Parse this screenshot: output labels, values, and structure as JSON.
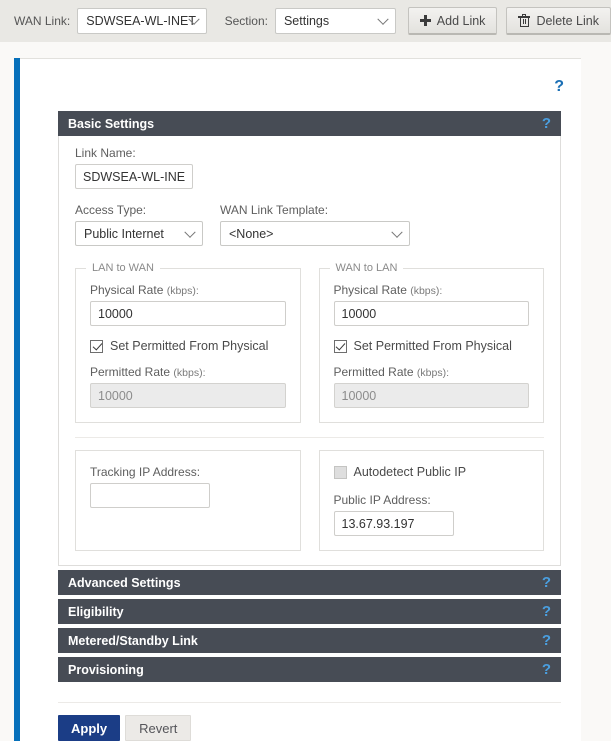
{
  "toolbar": {
    "wan_link_label": "WAN Link:",
    "wan_link_value": "SDWSEA-WL-INET",
    "section_label": "Section:",
    "section_value": "Settings",
    "add_link_label": "Add Link",
    "delete_link_label": "Delete Link"
  },
  "card": {
    "help_glyph": "?"
  },
  "basic_settings": {
    "title": "Basic Settings",
    "help_glyph": "?",
    "link_name_label": "Link Name:",
    "link_name_value": "SDWSEA-WL-INET",
    "access_type_label": "Access Type:",
    "access_type_value": "Public Internet",
    "wan_link_template_label": "WAN Link Template:",
    "wan_link_template_value": "<None>",
    "lan_to_wan": {
      "legend": "LAN to WAN",
      "physical_rate_label": "Physical Rate",
      "physical_rate_unit": "(kbps):",
      "physical_rate_value": "10000",
      "set_permitted_label": "Set Permitted From Physical",
      "set_permitted_checked": true,
      "permitted_rate_label": "Permitted Rate",
      "permitted_rate_unit": "(kbps):",
      "permitted_rate_value": "10000"
    },
    "wan_to_lan": {
      "legend": "WAN to LAN",
      "physical_rate_label": "Physical Rate",
      "physical_rate_unit": "(kbps):",
      "physical_rate_value": "10000",
      "set_permitted_label": "Set Permitted From Physical",
      "set_permitted_checked": true,
      "permitted_rate_label": "Permitted Rate",
      "permitted_rate_unit": "(kbps):",
      "permitted_rate_value": "10000"
    },
    "tracking": {
      "tracking_ip_label": "Tracking IP Address:",
      "tracking_ip_value": "",
      "autodetect_label": "Autodetect Public IP",
      "autodetect_checked": false,
      "public_ip_label": "Public IP Address:",
      "public_ip_value": "13.67.93.197"
    }
  },
  "sections": [
    {
      "title": "Advanced Settings",
      "help_glyph": "?"
    },
    {
      "title": "Eligibility",
      "help_glyph": "?"
    },
    {
      "title": "Metered/Standby Link",
      "help_glyph": "?"
    },
    {
      "title": "Provisioning",
      "help_glyph": "?"
    }
  ],
  "footer": {
    "apply_label": "Apply",
    "revert_label": "Revert"
  },
  "colors": {
    "accent_bar": "#0670ba",
    "accordion_header": "#474c55",
    "help_blue": "#4a9fe0",
    "apply_blue": "#1b3d86",
    "page_bg": "#e8e7e3"
  }
}
